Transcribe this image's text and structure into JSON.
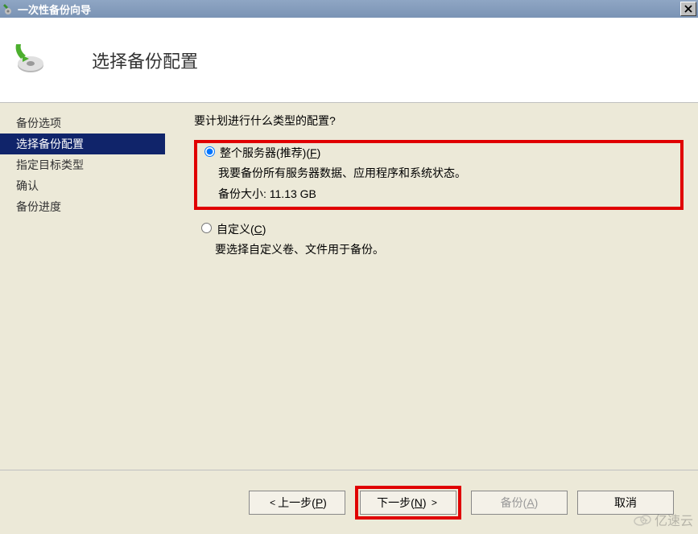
{
  "window": {
    "title": "一次性备份向导"
  },
  "header": {
    "title": "选择备份配置"
  },
  "sidebar": {
    "items": [
      {
        "label": "备份选项",
        "active": false
      },
      {
        "label": "选择备份配置",
        "active": true
      },
      {
        "label": "指定目标类型",
        "active": false
      },
      {
        "label": "确认",
        "active": false
      },
      {
        "label": "备份进度",
        "active": false
      }
    ]
  },
  "content": {
    "prompt": "要计划进行什么类型的配置?",
    "options": [
      {
        "selected": true,
        "highlighted": true,
        "label_pre": "整个服务器(推荐)(",
        "label_hotkey": "F",
        "label_post": ")",
        "desc_line1": "我要备份所有服务器数据、应用程序和系统状态。",
        "desc_line2": "备份大小: 11.13 GB"
      },
      {
        "selected": false,
        "highlighted": false,
        "label_pre": "自定义(",
        "label_hotkey": "C",
        "label_post": ")",
        "desc_line1": "要选择自定义卷、文件用于备份。",
        "desc_line2": ""
      }
    ]
  },
  "footer": {
    "prev_pre": "上一步(",
    "prev_hotkey": "P",
    "prev_post": ")",
    "next_pre": "下一步(",
    "next_hotkey": "N",
    "next_post": ")",
    "backup_pre": "备份(",
    "backup_hotkey": "A",
    "backup_post": ")",
    "cancel": "取消"
  },
  "watermark": "亿速云"
}
